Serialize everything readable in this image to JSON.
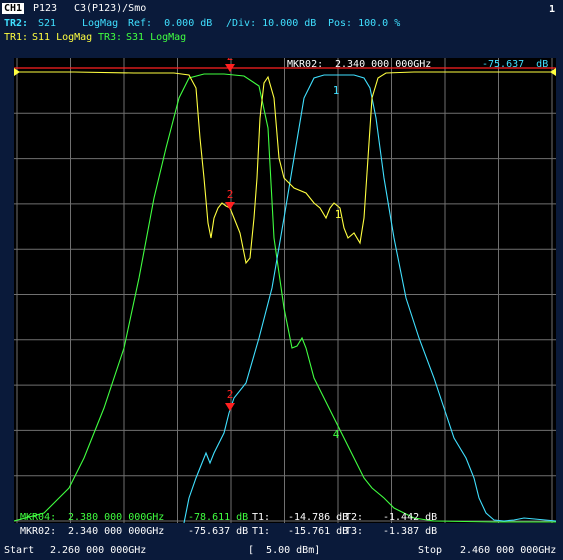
{
  "window": {
    "number": "1"
  },
  "header": {
    "channel": "CH1",
    "port": "P123",
    "calibration": "C3(P123)/Smo",
    "active_trace": {
      "label": "TR2:",
      "param": "S21",
      "format": "LogMag",
      "ref": "Ref:  0.000 dB",
      "div": "/Div: 10.000 dB",
      "pos": "Pos: 100.0 %"
    },
    "other_traces": [
      {
        "label": "TR1:",
        "text": "S11 LogMag",
        "color": "#ffff40"
      },
      {
        "label": "TR3:",
        "text": "S31 LogMag",
        "color": "#40ff40"
      }
    ]
  },
  "top_marker": {
    "label": "MKR02:",
    "freq": "2.340 000 000GHz",
    "value": "-75.637  dB",
    "number": "2"
  },
  "markers_table": [
    {
      "name": "MKR04:",
      "freq": "2.380 000 000GHz",
      "v1": "-78.611 dB",
      "t1": "T1:",
      "v2": "-14.786 dB",
      "t2": "T2:",
      "v3": "-1.442 dB",
      "color": "#40ff40"
    },
    {
      "name": "MKR02:",
      "freq": "2.340 000 000GHz",
      "v1": "-75.637 dB",
      "t1": "T1:",
      "v2": "-15.761 dB",
      "t2": "T3:",
      "v3": "-1.387 dB",
      "color": "#ffffff"
    }
  ],
  "footer": {
    "start_label": "Start",
    "start_value": "2.260 000 000GHz",
    "power": "[  5.00 dBm]",
    "stop_label": "Stop",
    "stop_value": "2.460 000 000GHz"
  },
  "marker_numbers": {
    "m1": "1",
    "m2": "2",
    "m4": "4"
  },
  "colors": {
    "tr1": "#ffff40",
    "tr2": "#40e0ff",
    "tr3": "#40ff40",
    "marker": "#ff2020",
    "grid": "#707070"
  },
  "chart_data": {
    "type": "line",
    "x_range": [
      2.26,
      2.46
    ],
    "y_range": [
      -100,
      0
    ],
    "grid": true,
    "series": [
      {
        "name": "S11",
        "color": "#ffff40"
      },
      {
        "name": "S21",
        "color": "#40e0ff"
      },
      {
        "name": "S31",
        "color": "#40ff40"
      }
    ]
  }
}
